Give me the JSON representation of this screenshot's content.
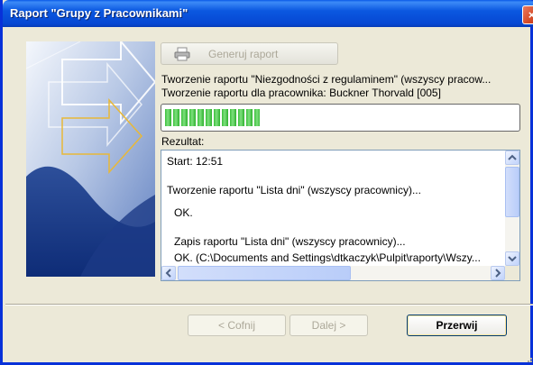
{
  "window": {
    "title": "Raport \"Grupy z Pracownikami\"",
    "close_glyph": "×"
  },
  "actions": {
    "generate_label": "Generuj raport",
    "generate_icon": "printer-icon"
  },
  "status": {
    "line1": "Tworzenie raportu \"Niezgodności z regulaminem\" (wszyscy pracow...",
    "line2": "Tworzenie raportu dla pracownika: Buckner Thorvald [005]"
  },
  "progress": {
    "fraction": 0.27,
    "color": "#2eb12e"
  },
  "result": {
    "label": "Rezultat:",
    "lines": [
      "Start: 12:51",
      "Tworzenie raportu \"Lista dni\" (wszyscy pracownicy)...",
      "OK.",
      "Zapis raportu \"Lista dni\" (wszyscy pracownicy)...",
      "OK. (C:\\Documents and Settings\\dtkaczyk\\Pulpit\\raporty\\Wszy..."
    ]
  },
  "footer": {
    "back_label": "< Cofnij",
    "next_label": "Dalej >",
    "abort_label": "Przerwij"
  }
}
